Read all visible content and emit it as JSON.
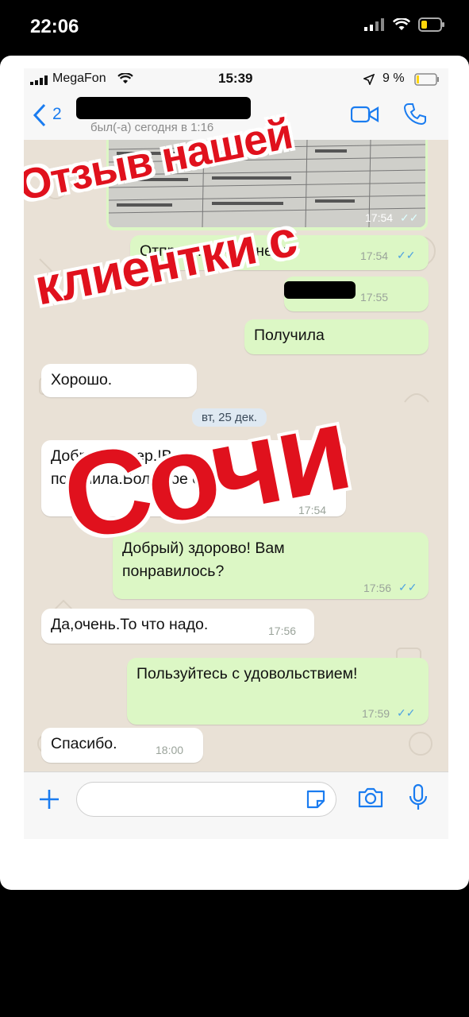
{
  "outer_status": {
    "time": "22:06"
  },
  "inner_status": {
    "carrier": "MegaFon",
    "time": "15:39",
    "battery": "9 %"
  },
  "header": {
    "back_count": "2",
    "last_seen": "был(-а) сегодня в 1:16"
  },
  "messages": [
    {
      "dir": "out",
      "text": "Отправляйте денежку",
      "time": "17:54"
    },
    {
      "dir": "out",
      "text": "",
      "time": "17:55"
    },
    {
      "dir": "out",
      "text": "Получила",
      "time": ""
    },
    {
      "dir": "in",
      "text": "Хорошо.",
      "time": ""
    },
    {
      "dir": "in",
      "text": "Добрый вечер.!Все получила.Большое спасибо.👍",
      "time": "17:54"
    },
    {
      "dir": "out",
      "text": "Добрый) здорово! Вам понравилось?",
      "time": "17:56"
    },
    {
      "dir": "in",
      "text": "Да,очень.То что надо.",
      "time": "17:56"
    },
    {
      "dir": "out",
      "text": "Пользуйтесь с удовольствием!",
      "time": "17:59"
    },
    {
      "dir": "in",
      "text": "Спасибо.",
      "time": "18:00"
    }
  ],
  "image_message": {
    "time": "17:54"
  },
  "date_separator": "вт, 25 дек.",
  "overlay": {
    "line1": "Отзыв нашей",
    "line2": "клиентки с",
    "line3": "Сочи"
  },
  "colors": {
    "overlay_red": "#e0111d",
    "ios_blue": "#1a7cf0",
    "bubble_out": "#dcf7c5",
    "bubble_in": "#ffffff"
  },
  "icons": [
    "signal-icon",
    "wifi-icon",
    "battery-icon",
    "back-chevron-icon",
    "video-call-icon",
    "phone-icon",
    "plus-icon",
    "sticker-icon",
    "camera-icon",
    "microphone-icon",
    "double-check-icon"
  ]
}
